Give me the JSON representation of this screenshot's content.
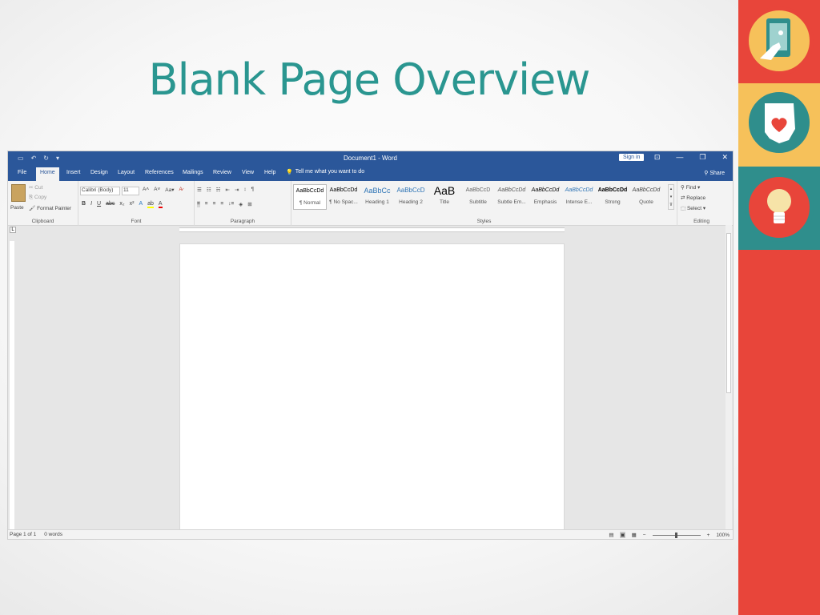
{
  "slide": {
    "title": "Blank Page Overview"
  },
  "decor": {
    "colors": {
      "red": "#e8453a",
      "yellow": "#f6c15a",
      "teal": "#2f8e8c"
    },
    "icons": [
      "tablet-touch-icon",
      "ohio-heart-icon",
      "lightbulb-icon"
    ]
  },
  "word": {
    "window_title": "Document1 - Word",
    "sign_in": "Sign in",
    "tabs": [
      "File",
      "Home",
      "Insert",
      "Design",
      "Layout",
      "References",
      "Mailings",
      "Review",
      "View",
      "Help"
    ],
    "active_tab": "Home",
    "tell_me": "Tell me what you want to do",
    "share": "Share",
    "clipboard": {
      "paste": "Paste",
      "cut": "Cut",
      "copy": "Copy",
      "format_painter": "Format Painter",
      "label": "Clipboard"
    },
    "font": {
      "name": "Calibri (Body)",
      "size": "11",
      "label": "Font"
    },
    "paragraph": {
      "label": "Paragraph"
    },
    "styles": {
      "label": "Styles",
      "items": [
        {
          "preview": "AaBbCcDd",
          "name": "¶ Normal"
        },
        {
          "preview": "AaBbCcDd",
          "name": "¶ No Spac..."
        },
        {
          "preview": "AaBbCc",
          "name": "Heading 1"
        },
        {
          "preview": "AaBbCcD",
          "name": "Heading 2"
        },
        {
          "preview": "AaB",
          "name": "Title"
        },
        {
          "preview": "AaBbCcD",
          "name": "Subtitle"
        },
        {
          "preview": "AaBbCcDd",
          "name": "Subtle Em..."
        },
        {
          "preview": "AaBbCcDd",
          "name": "Emphasis"
        },
        {
          "preview": "AaBbCcDd",
          "name": "Intense E..."
        },
        {
          "preview": "AaBbCcDd",
          "name": "Strong"
        },
        {
          "preview": "AaBbCcDd",
          "name": "Quote"
        }
      ]
    },
    "editing": {
      "find": "Find",
      "replace": "Replace",
      "select": "Select",
      "label": "Editing"
    },
    "status": {
      "page": "Page 1 of 1",
      "words": "0 words",
      "zoom": "100%"
    },
    "accent": "#2b579a"
  }
}
